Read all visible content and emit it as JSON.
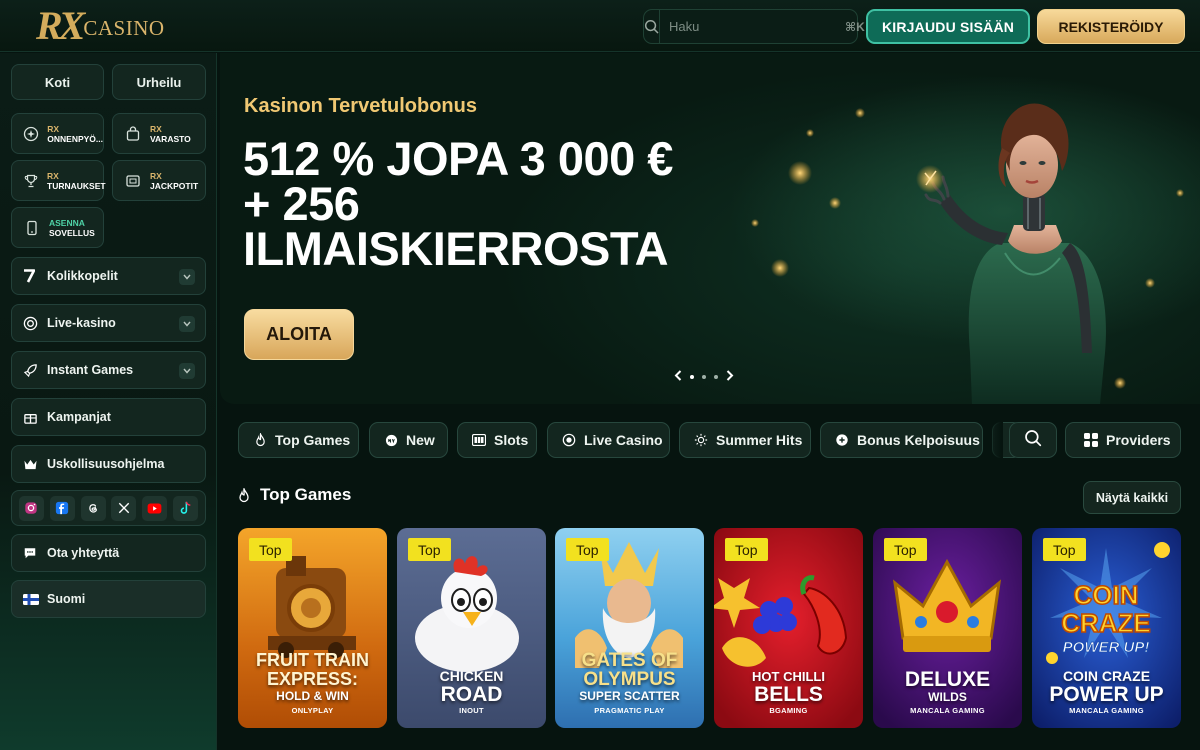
{
  "header": {
    "logo_rx": "RX",
    "logo_text": "CASINO",
    "search_placeholder": "Haku",
    "search_shortcut": "⌘K",
    "login_label": "KIRJAUDU SISÄÄN",
    "register_label": "REKISTERÖIDY"
  },
  "sidebar": {
    "top_buttons": [
      "Koti",
      "Urheilu"
    ],
    "tiles": [
      {
        "prefix": "RX",
        "label": "ONNENPYÖ...",
        "icon": "wheel-icon"
      },
      {
        "prefix": "RX",
        "label": "VARASTO",
        "icon": "bag-icon"
      },
      {
        "prefix": "RX",
        "label": "TURNAUKSET",
        "icon": "trophy-icon"
      },
      {
        "prefix": "RX",
        "label": "JACKPOTIT",
        "icon": "jackpot-icon"
      },
      {
        "prefix": "ASENNA",
        "label": "SOVELLUS",
        "icon": "phone-icon"
      }
    ],
    "rows": [
      {
        "label": "Kolikkopelit",
        "icon": "seven-icon",
        "expandable": true
      },
      {
        "label": "Live-kasino",
        "icon": "chip-icon",
        "expandable": true
      },
      {
        "label": "Instant Games",
        "icon": "rocket-icon",
        "expandable": true
      },
      {
        "label": "Kampanjat",
        "icon": "gift-icon",
        "expandable": false
      },
      {
        "label": "Uskollisuusohjelma",
        "icon": "crown-icon",
        "expandable": false
      }
    ],
    "socials": [
      "instagram-icon",
      "facebook-icon",
      "threads-icon",
      "x-icon",
      "youtube-icon",
      "tiktok-icon"
    ],
    "contact_label": "Ota yhteyttä",
    "language_label": "Suomi"
  },
  "hero": {
    "subtitle": "Kasinon Tervetulobonus",
    "title": "512 % JOPA 3 000 € + 256 ILMAISKIERROSTA",
    "cta_label": "ALOITA",
    "slide_count": 3,
    "active_slide": 1
  },
  "categories": {
    "tabs": [
      {
        "label": "Top Games",
        "icon": "fire-icon"
      },
      {
        "label": "New",
        "icon": "new-icon"
      },
      {
        "label": "Slots",
        "icon": "slots-icon"
      },
      {
        "label": "Live Casino",
        "icon": "chip-icon"
      },
      {
        "label": "Summer Hits",
        "icon": "sun-icon"
      },
      {
        "label": "Bonus Kelpoisuus",
        "icon": "bonus-icon"
      }
    ],
    "providers_label": "Providers"
  },
  "section": {
    "title": "Top Games",
    "show_all_label": "Näytä kaikki"
  },
  "games": [
    {
      "badge": "Top",
      "title_1": "FRUIT TRAIN",
      "title_2": "EXPRESS:",
      "title_3": "HOLD & WIN",
      "provider": "ONLYPLAY"
    },
    {
      "badge": "Top",
      "title_1": "CHICKEN",
      "title_2": "ROAD",
      "title_3": "",
      "provider": "INOUT"
    },
    {
      "badge": "Top",
      "title_1": "GATES OF",
      "title_2": "OLYMPUS",
      "title_3": "SUPER SCATTER",
      "provider": "PRAGMATIC PLAY"
    },
    {
      "badge": "Top",
      "title_1": "HOT CHILLI",
      "title_2": "BELLS",
      "title_3": "",
      "provider": "BGAMING"
    },
    {
      "badge": "Top",
      "title_1": "DELUXE",
      "title_2": "WILDS",
      "title_3": "",
      "provider": "MANCALA GAMING"
    },
    {
      "badge": "Top",
      "title_1": "COIN CRAZE",
      "title_2": "POWER UP",
      "title_3": "",
      "provider": "MANCALA GAMING"
    }
  ],
  "colors": {
    "accent_gold": "#d8a95b",
    "accent_teal": "#0e6b57",
    "badge_yellow": "#f2e11f",
    "background": "#06140f"
  }
}
